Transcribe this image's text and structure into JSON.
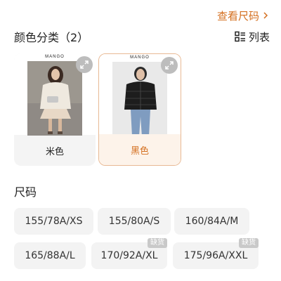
{
  "header": {
    "size_guide_label": "查看尺码",
    "color_section_title": "颜色分类（2）",
    "list_toggle_label": "列表"
  },
  "colors": {
    "brand": "MANGO",
    "items": [
      {
        "label": "米色",
        "selected": false
      },
      {
        "label": "黑色",
        "selected": true
      }
    ]
  },
  "sizes": {
    "title": "尺码",
    "items": [
      {
        "label": "155/78A/XS"
      },
      {
        "label": "155/80A/S"
      },
      {
        "label": "160/84A/M"
      },
      {
        "label": "165/88A/L"
      },
      {
        "label": "170/92A/XL",
        "badge": "缺货"
      },
      {
        "label": "175/96A/XXL",
        "badge": "缺货"
      }
    ]
  },
  "theme": {
    "accent": "#d46f1f",
    "selected_bg": "#fdf3ea",
    "chip_bg": "#f3f3f3"
  }
}
